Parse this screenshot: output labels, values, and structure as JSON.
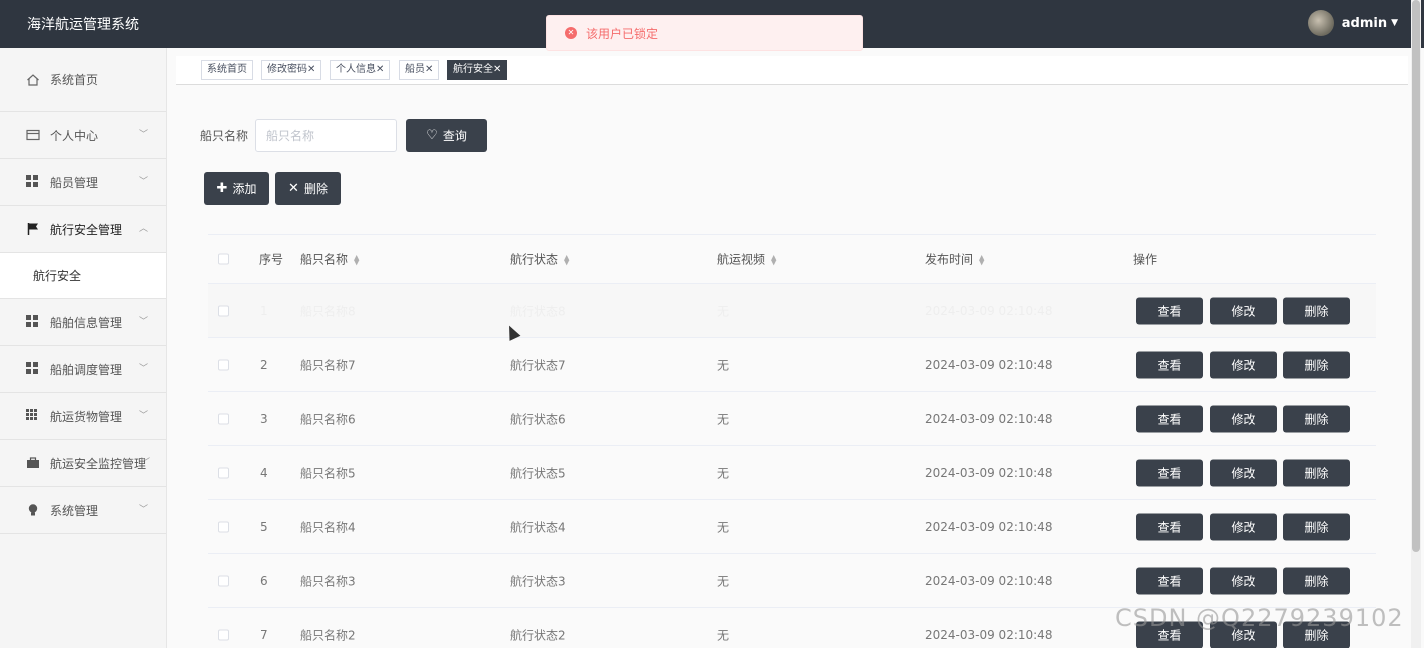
{
  "header": {
    "app_title": "海洋航运管理系统",
    "username": "admin",
    "caret": "▼"
  },
  "toast": {
    "message": "该用户已锁定",
    "icon": "error-circle-icon"
  },
  "sidebar": {
    "items": [
      {
        "label": "系统首页",
        "icon": "home-icon",
        "expandable": false
      },
      {
        "label": "个人中心",
        "icon": "profile-card-icon",
        "expandable": true
      },
      {
        "label": "船员管理",
        "icon": "grid-icon",
        "expandable": true
      },
      {
        "label": "航行安全管理",
        "icon": "flag-icon",
        "expandable": true,
        "expanded": true
      },
      {
        "label": "船舶信息管理",
        "icon": "grid-icon",
        "expandable": true
      },
      {
        "label": "船舶调度管理",
        "icon": "grid-icon",
        "expandable": true
      },
      {
        "label": "航运货物管理",
        "icon": "grid9-icon",
        "expandable": true
      },
      {
        "label": "航运安全监控管理",
        "icon": "briefcase-icon",
        "expandable": true
      },
      {
        "label": "系统管理",
        "icon": "lightbulb-icon",
        "expandable": true
      }
    ],
    "submenu": {
      "label": "航行安全"
    }
  },
  "tabs": [
    {
      "label": "系统首页",
      "closable": false,
      "active": false
    },
    {
      "label": "修改密码",
      "closable": true,
      "active": false
    },
    {
      "label": "个人信息",
      "closable": true,
      "active": false
    },
    {
      "label": "船员",
      "closable": true,
      "active": false
    },
    {
      "label": "航行安全",
      "closable": true,
      "active": true
    }
  ],
  "search": {
    "label": "船只名称",
    "placeholder": "船只名称",
    "value": "",
    "query_button": "查询"
  },
  "actions": {
    "add": "添加",
    "delete": "删除"
  },
  "table": {
    "columns": {
      "index": "序号",
      "ship_name": "船只名称",
      "nav_status": "航行状态",
      "video": "航运视频",
      "publish_time": "发布时间",
      "ops": "操作"
    },
    "rows": [
      {
        "index": "1",
        "ship_name": "船只名称8",
        "nav_status": "航行状态8",
        "video": "无",
        "publish_time": "2024-03-09 02:10:48"
      },
      {
        "index": "2",
        "ship_name": "船只名称7",
        "nav_status": "航行状态7",
        "video": "无",
        "publish_time": "2024-03-09 02:10:48"
      },
      {
        "index": "3",
        "ship_name": "船只名称6",
        "nav_status": "航行状态6",
        "video": "无",
        "publish_time": "2024-03-09 02:10:48"
      },
      {
        "index": "4",
        "ship_name": "船只名称5",
        "nav_status": "航行状态5",
        "video": "无",
        "publish_time": "2024-03-09 02:10:48"
      },
      {
        "index": "5",
        "ship_name": "船只名称4",
        "nav_status": "航行状态4",
        "video": "无",
        "publish_time": "2024-03-09 02:10:48"
      },
      {
        "index": "6",
        "ship_name": "船只名称3",
        "nav_status": "航行状态3",
        "video": "无",
        "publish_time": "2024-03-09 02:10:48"
      },
      {
        "index": "7",
        "ship_name": "船只名称2",
        "nav_status": "航行状态2",
        "video": "无",
        "publish_time": "2024-03-09 02:10:48"
      }
    ],
    "row_actions": {
      "view": "查看",
      "edit": "修改",
      "delete": "删除"
    }
  },
  "watermark": "CSDN @Q2279239102"
}
